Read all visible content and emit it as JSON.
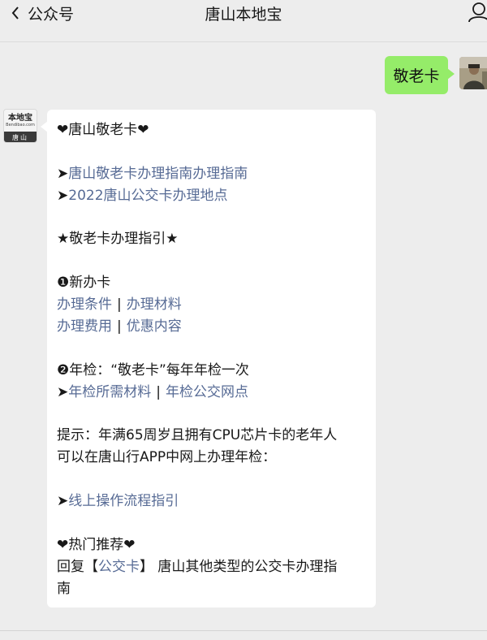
{
  "nav": {
    "back_label": "公众号",
    "title": "唐山本地宝"
  },
  "outgoing": {
    "text": "敬老卡"
  },
  "incoming_avatar": {
    "main": "本地宝",
    "sub": "Bendibao.com",
    "city": "唐山"
  },
  "message": {
    "heading": "❤唐山敬老卡❤",
    "guide_links": [
      {
        "arrow": "➤",
        "text": "唐山敬老卡办理指南办理指南"
      },
      {
        "arrow": "➤",
        "text": "2022唐山公交卡办理地点"
      }
    ],
    "section_title": "★敬老卡办理指引★",
    "new_card": {
      "title": "❶新办卡",
      "row1": [
        "办理条件",
        "办理材料"
      ],
      "row2": [
        "办理费用",
        "优惠内容"
      ],
      "separator": "|"
    },
    "annual": {
      "title": "❷年检：“敬老卡”每年年检一次",
      "arrow": "➤",
      "links": [
        "年检所需材料",
        "年检公交网点"
      ],
      "separator": "|"
    },
    "tip_line1": "提示：年满65周岁且拥有CPU芯片卡的老年人",
    "tip_line2": "可以在唐山行APP中网上办理年检：",
    "online": {
      "arrow": "➤",
      "text": "线上操作流程指引"
    },
    "hot_title": "❤热门推荐❤",
    "reply_prefix": "回复",
    "reply_open": "【",
    "reply_keyword": "公交卡",
    "reply_close": "】",
    "reply_suffix_line1": " 唐山其他类型的公交卡办理指",
    "reply_suffix_line2": "南"
  },
  "colors": {
    "link": "#576b95",
    "bubble_out": "#95ec69",
    "background": "#ededed"
  }
}
